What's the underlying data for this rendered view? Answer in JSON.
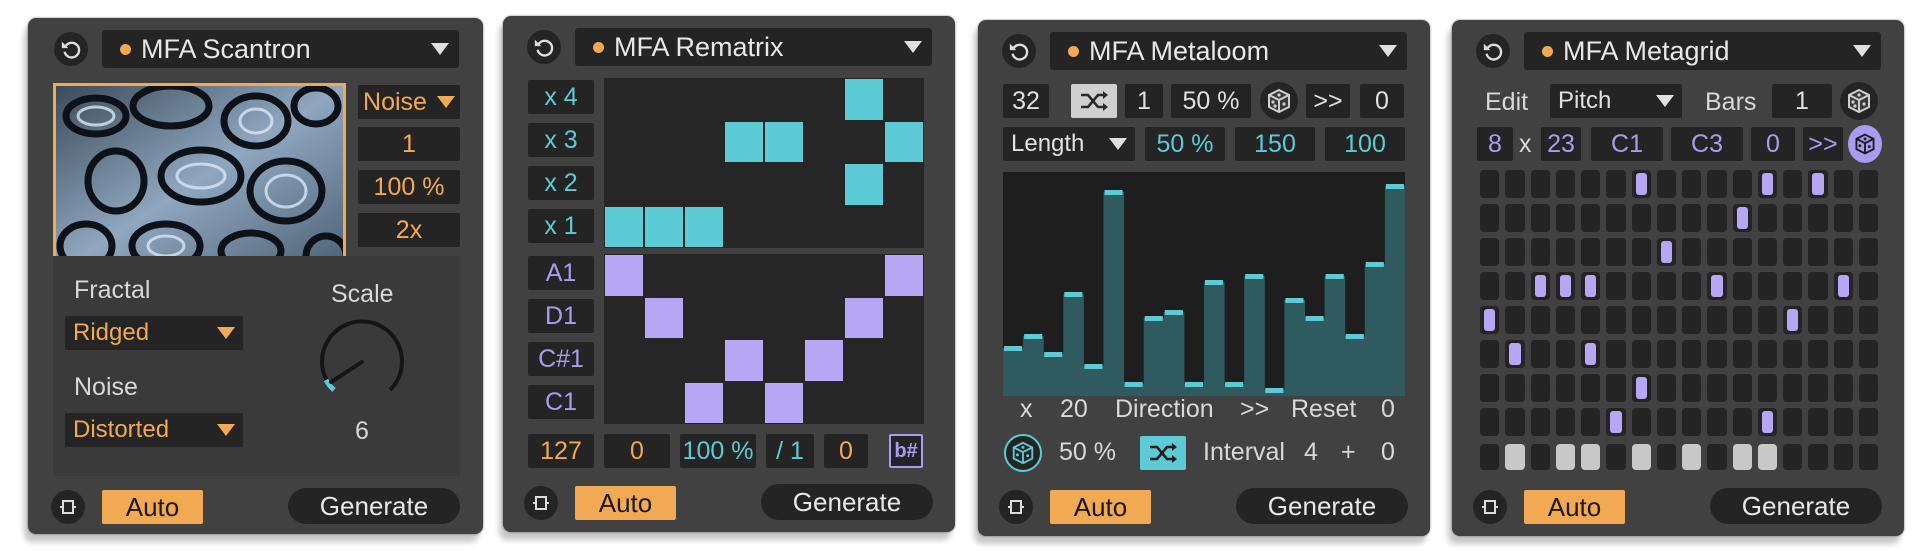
{
  "scantron": {
    "title": "MFA Scantron",
    "noise_dropdown": "Noise",
    "value1": "1",
    "value2": "100 %",
    "value3": "2x",
    "fractal_label": "Fractal",
    "fractal_value": "Ridged",
    "noise_label": "Noise",
    "noise_value": "Distorted",
    "scale_label": "Scale",
    "scale_value": "6",
    "auto_label": "Auto",
    "generate_label": "Generate"
  },
  "rematrix": {
    "title": "MFA Rematrix",
    "top_rows": [
      "x 4",
      "x 3",
      "x 2",
      "x 1"
    ],
    "bottom_rows": [
      "A1",
      "D1",
      "C#1",
      "C1"
    ],
    "top_cells": [
      [
        6,
        0
      ],
      [
        3,
        1
      ],
      [
        4,
        1
      ],
      [
        7,
        1
      ],
      [
        6,
        2
      ],
      [
        0,
        3
      ],
      [
        1,
        3
      ],
      [
        2,
        3
      ]
    ],
    "bottom_cells": [
      [
        0,
        0
      ],
      [
        7,
        0
      ],
      [
        1,
        1
      ],
      [
        6,
        1
      ],
      [
        3,
        2
      ],
      [
        5,
        2
      ],
      [
        2,
        3
      ],
      [
        4,
        3
      ]
    ],
    "velocity": "127",
    "offset": "0",
    "percent": "100 %",
    "division": "/ 1",
    "transpose": "0",
    "accidental": "b#",
    "auto_label": "Auto",
    "generate_label": "Generate"
  },
  "metaloom": {
    "title": "MFA Metaloom",
    "steps": "32",
    "shuffle_value": "1",
    "percent1": "50 %",
    "shift_label": ">>",
    "shift_value": "0",
    "mode": "Length",
    "percent2": "50 %",
    "value_150": "150",
    "value_100": "100",
    "bar_values": [
      8,
      10,
      7,
      17,
      5,
      34,
      2,
      13,
      14,
      2,
      19,
      2,
      20,
      1,
      16,
      13,
      20,
      10,
      22,
      35
    ],
    "x_label": "x",
    "x_value": "20",
    "direction_label": "Direction",
    "direction_value": ">>",
    "reset_label": "Reset",
    "reset_value": "0",
    "rand_percent": "50 %",
    "interval_label": "Interval",
    "interval_value": "4",
    "plus_label": "+",
    "interval_offset": "0",
    "auto_label": "Auto",
    "generate_label": "Generate"
  },
  "metagrid": {
    "title": "MFA Metagrid",
    "edit_label": "Edit",
    "edit_mode": "Pitch",
    "bars_label": "Bars",
    "bars_value": "1",
    "cols": "8",
    "x_label": "x",
    "rows": "23",
    "low_note": "C1",
    "high_note": "C3",
    "shift_value": "0",
    "shift_label": ">>",
    "notes": [
      [
        6,
        0
      ],
      [
        11,
        0
      ],
      [
        13,
        0
      ],
      [
        10,
        1
      ],
      [
        7,
        2
      ],
      [
        2,
        3
      ],
      [
        3,
        3
      ],
      [
        4,
        3
      ],
      [
        9,
        3
      ],
      [
        14,
        3
      ],
      [
        0,
        4
      ],
      [
        12,
        4
      ],
      [
        1,
        5
      ],
      [
        4,
        5
      ],
      [
        6,
        6
      ],
      [
        5,
        7
      ],
      [
        11,
        7
      ]
    ],
    "accents": [
      1,
      3,
      4,
      6,
      8,
      10,
      11
    ],
    "auto_label": "Auto",
    "generate_label": "Generate",
    "colors": {
      "accent_orange": "#f2a953",
      "cyan": "#5ccbd6",
      "purple": "#a99cf0",
      "panel": "#414141",
      "field": "#242424"
    }
  }
}
